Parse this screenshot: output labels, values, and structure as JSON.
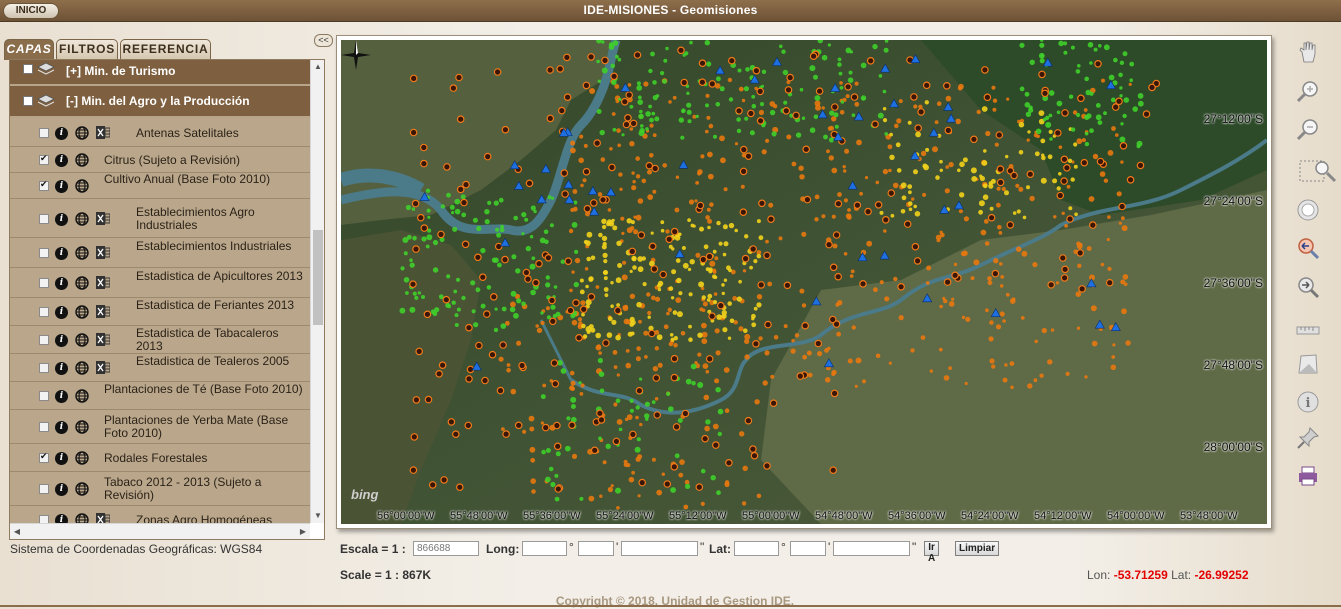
{
  "header": {
    "home_button": "INICIO",
    "title": "IDE-MISIONES - Geomisiones"
  },
  "tabs": [
    {
      "label": "CAPAS",
      "active": true
    },
    {
      "label": "FILTROS",
      "active": false
    },
    {
      "label": "REFERENCIA",
      "active": false
    }
  ],
  "collapse_label": "<<",
  "layer_groups": [
    {
      "label": "[+] Min. de Turismo",
      "expanded": false
    },
    {
      "label": "[-] Min. del Agro y la Producción",
      "expanded": true
    }
  ],
  "layers": [
    {
      "label": "Antenas Satelitales",
      "checked": false,
      "excel": true
    },
    {
      "label": "Citrus (Sujeto a Revisión)",
      "checked": true,
      "excel": false
    },
    {
      "label": "Cultivo Anual (Base Foto 2010)",
      "checked": true,
      "excel": false
    },
    {
      "label": "Establecimientos Agro Industriales",
      "checked": false,
      "excel": true
    },
    {
      "label": "Establecimientos Industriales",
      "checked": false,
      "excel": true
    },
    {
      "label": "Estadistica de Apicultores 2013",
      "checked": false,
      "excel": true
    },
    {
      "label": "Estadistica de Feriantes 2013",
      "checked": false,
      "excel": true
    },
    {
      "label": "Estadistica de Tabacaleros 2013",
      "checked": false,
      "excel": true
    },
    {
      "label": "Estadistica de Tealeros 2005",
      "checked": false,
      "excel": true
    },
    {
      "label": "Plantaciones de Té (Base Foto 2010)",
      "checked": false,
      "excel": false
    },
    {
      "label": "Plantaciones de Yerba Mate (Base Foto 2010)",
      "checked": false,
      "excel": false
    },
    {
      "label": "Rodales Forestales",
      "checked": true,
      "excel": false
    },
    {
      "label": "Tabaco 2012 - 2013 (Sujeto a Revisión)",
      "checked": false,
      "excel": false
    },
    {
      "label": "Zonas Agro Homogéneas",
      "checked": false,
      "excel": true
    }
  ],
  "coord_system": "Sistema de Coordenadas Geográficas: WGS84",
  "map": {
    "lat_labels": [
      "27°12'00\"S",
      "27°24'00\"S",
      "27°36'00\"S",
      "27°48'00\"S",
      "28°00'00\"S"
    ],
    "lon_labels": [
      "56°00'00\"W",
      "55°48'00\"W",
      "55°36'00\"W",
      "55°24'00\"W",
      "55°12'00\"W",
      "55°00'00\"W",
      "54°48'00\"W",
      "54°36'00\"W",
      "54°24'00\"W",
      "54°12'00\"W",
      "54°00'00\"W",
      "53°48'00\"W"
    ],
    "provider_logo": "bing",
    "colors": {
      "orange_points": "#e8780e",
      "yellow_points": "#f2d21b",
      "green_points": "#3fcf2a",
      "blue_points": "#1e6fe0",
      "river": "#4b7a88"
    }
  },
  "tools": [
    "pan-icon",
    "zoom-in-icon",
    "zoom-out-icon",
    "zoom-box-icon",
    "full-extent-icon",
    "zoom-previous-icon",
    "zoom-next-icon",
    "measure-icon",
    "area-icon",
    "identify-icon",
    "pin-icon",
    "print-icon"
  ],
  "controls": {
    "scale_label": "Escala = 1 :",
    "scale_value": "866688",
    "long_label": "Long:",
    "lat_label": "Lat:",
    "deg": "°",
    "min": "'",
    "sec": "\"",
    "go_button": "Ir A",
    "clear_button": "Limpiar",
    "scale_text": "Scale = 1 : 867K",
    "lon_label": "Lon:",
    "lon_value": "-53.71259",
    "lat_label2": "Lat:",
    "lat_value": "-26.99252"
  },
  "copyright": "Copyright © 2018. Unidad de Gestion IDE."
}
